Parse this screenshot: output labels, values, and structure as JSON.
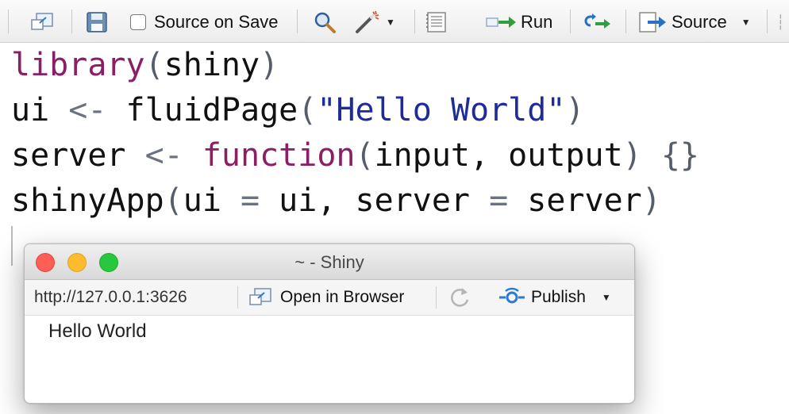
{
  "toolbar": {
    "source_on_save_label": "Source on Save",
    "run_label": "Run",
    "source_label": "Source",
    "icons": [
      "show-in-window-icon",
      "save-icon",
      "search-icon",
      "code-tools-wand-icon",
      "compile-report-icon",
      "run-icon",
      "rerun-icon",
      "source-icon"
    ]
  },
  "editor": {
    "lines": [
      "library(shiny)",
      "ui <- fluidPage(\"Hello World\")",
      "server <- function(input, output) {}",
      "shinyApp(ui = ui, server = server)"
    ],
    "tokens": {
      "l1": [
        "library",
        "(",
        "shiny",
        ")"
      ],
      "l2": [
        "ui",
        " <- ",
        "fluidPage",
        "(",
        "\"Hello World\"",
        ")"
      ],
      "l3": [
        "server",
        " <- ",
        "function",
        "(",
        "input, output",
        ")",
        " {}"
      ],
      "l4": [
        "shinyApp",
        "(",
        "ui",
        " = ",
        "ui, server",
        " = ",
        "server",
        ")"
      ]
    }
  },
  "shiny_window": {
    "title": "~ - Shiny",
    "url": "http://127.0.0.1:3626",
    "open_in_browser_label": "Open in Browser",
    "publish_label": "Publish",
    "content_text": "Hello World"
  },
  "colors": {
    "keyword": "#8b1f66",
    "string": "#1d2b9b",
    "operator": "#6c7380",
    "accent_blue": "#2b7bd6",
    "run_green": "#2f9e3e"
  }
}
